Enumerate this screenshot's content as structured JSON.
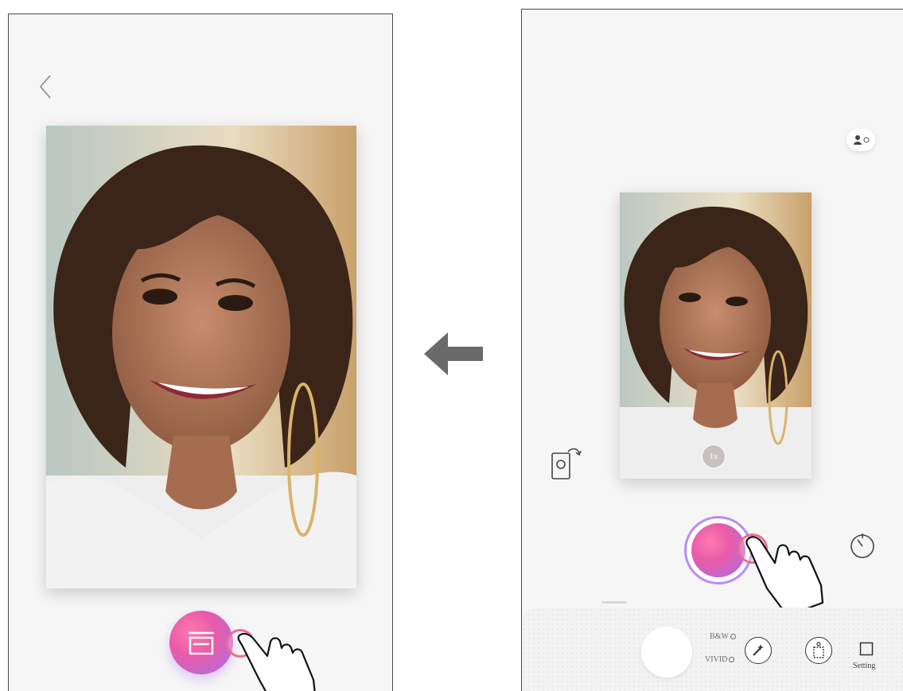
{
  "right_screen": {
    "zoom_badge": "1x",
    "modes": {
      "bw_label": "B&W",
      "vivid_label": "VIVID"
    },
    "setting_label": "Setting"
  },
  "icons": {
    "back": "chevron-left-icon",
    "flow_arrow": "arrow-left-icon",
    "print": "print-icon",
    "flip_camera": "flip-camera-icon",
    "auto_beauty": "person-sparkle-icon",
    "timer": "timer-icon",
    "magic": "magic-wand-icon",
    "frame": "frame-icon",
    "setting": "square-icon",
    "tap_hand": "hand-pointer-icon"
  },
  "colors": {
    "accent_pink": "#e85ba8",
    "accent_purple": "#a66ef0",
    "tap_ring": "#f06a8c",
    "background": "#f6f6f6"
  }
}
